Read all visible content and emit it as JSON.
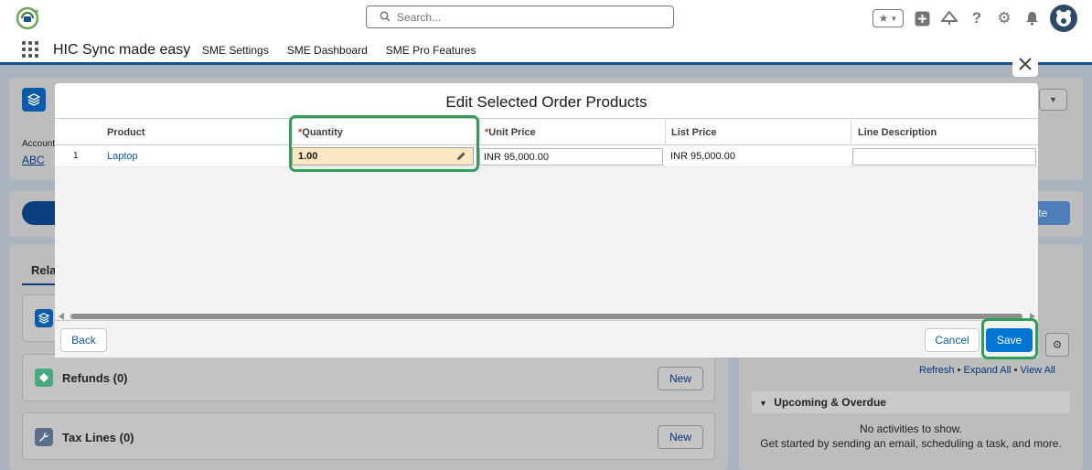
{
  "header": {
    "search_placeholder": "Search..."
  },
  "app_nav": {
    "app_name": "HIC Sync made easy",
    "items": [
      "SME Settings",
      "SME Dashboard",
      "SME Pro Features"
    ]
  },
  "background": {
    "account_label": "Account",
    "account_value": "ABC",
    "right_button": "lete",
    "related_tab": "Rela",
    "refunds_title": "Refunds (0)",
    "tax_lines_title": "Tax Lines (0)",
    "new_label": "New",
    "activity_links": [
      "Refresh",
      "Expand All",
      "View All"
    ],
    "upcoming_title": "Upcoming & Overdue",
    "no_activities": "No activities to show.",
    "get_started": "Get started by sending an email, scheduling a task, and more."
  },
  "modal": {
    "title": "Edit Selected Order Products",
    "columns": {
      "product": "Product",
      "quantity": "Quantity",
      "unit_price": "Unit Price",
      "list_price": "List Price",
      "line_description": "Line Description"
    },
    "required_marker": "*",
    "rows": [
      {
        "index": "1",
        "product": "Laptop",
        "quantity": "1.00",
        "unit_price": "INR 95,000.00",
        "list_price": "INR 95,000.00",
        "line_description": ""
      }
    ],
    "buttons": {
      "back": "Back",
      "cancel": "Cancel",
      "save": "Save"
    }
  },
  "colors": {
    "brand": "#0176d3",
    "highlight": "#2e9e58",
    "edited_cell": "#fce7c2",
    "required": "#c23934"
  }
}
